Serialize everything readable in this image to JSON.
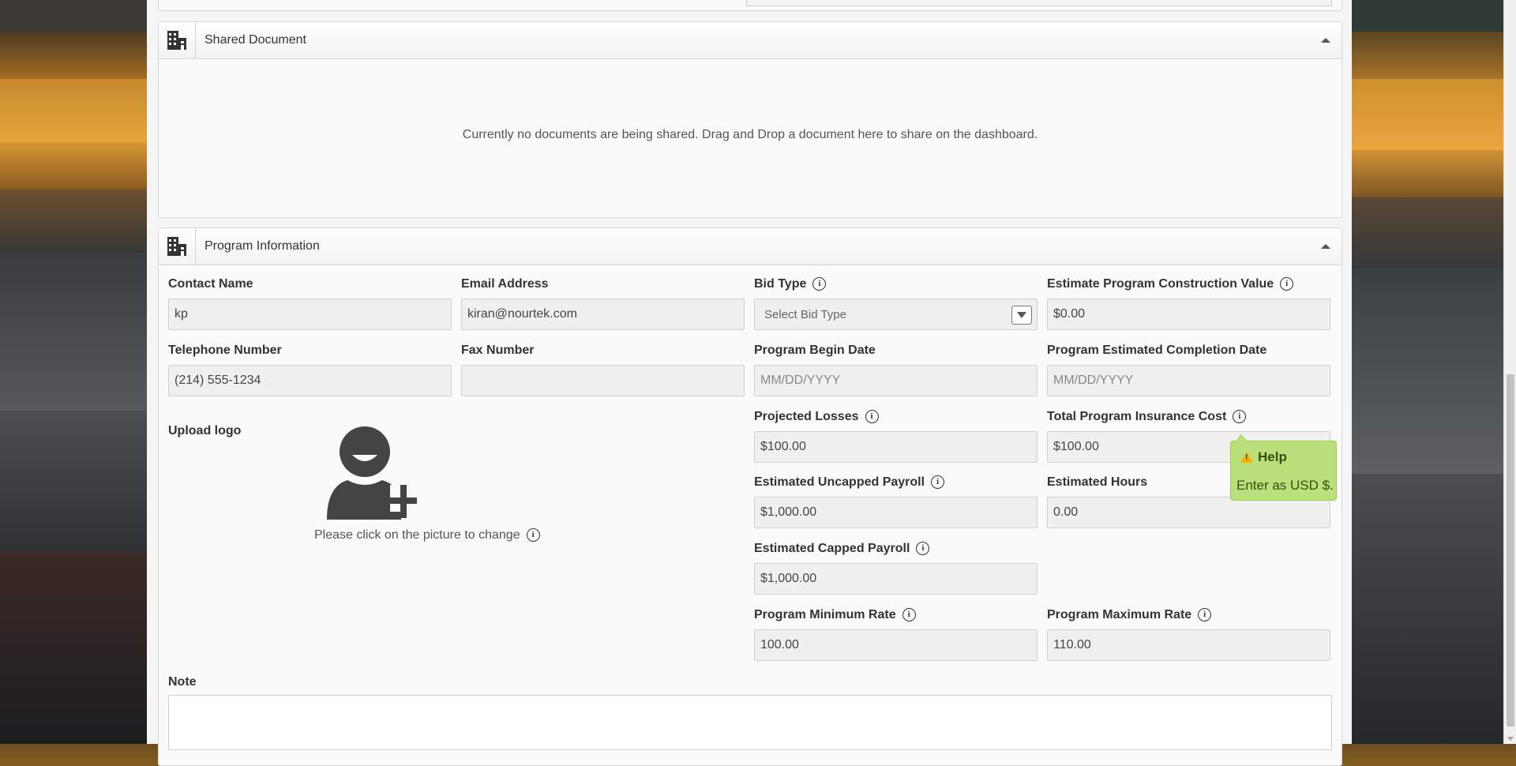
{
  "shared_document": {
    "title": "Shared Document",
    "empty_message": "Currently no documents are being shared. Drag and Drop a document here to share on the dashboard."
  },
  "program_information": {
    "title": "Program Information",
    "contact_name": {
      "label": "Contact Name",
      "value": "kp"
    },
    "email_address": {
      "label": "Email Address",
      "value": "kiran@nourtek.com"
    },
    "bid_type": {
      "label": "Bid Type",
      "value": "Select Bid Type"
    },
    "estimate_construction_value": {
      "label": "Estimate Program Construction Value",
      "value": "$0.00"
    },
    "telephone_number": {
      "label": "Telephone Number",
      "value": "(214) 555-1234"
    },
    "fax_number": {
      "label": "Fax Number",
      "value": ""
    },
    "program_begin_date": {
      "label": "Program Begin Date",
      "placeholder": "MM/DD/YYYY"
    },
    "program_completion_date": {
      "label": "Program Estimated Completion Date",
      "placeholder": "MM/DD/YYYY"
    },
    "upload_logo": {
      "label": "Upload logo",
      "caption": "Please click on the picture to change"
    },
    "projected_losses": {
      "label": "Projected Losses",
      "value": "$100.00"
    },
    "total_insurance_cost": {
      "label": "Total Program Insurance Cost",
      "value": "$100.00"
    },
    "estimated_uncapped_payroll": {
      "label": "Estimated Uncapped Payroll",
      "value": "$1,000.00"
    },
    "estimated_hours": {
      "label": "Estimated Hours",
      "value": "0.00"
    },
    "estimated_capped_payroll": {
      "label": "Estimated Capped Payroll",
      "value": "$1,000.00"
    },
    "program_minimum_rate": {
      "label": "Program Minimum Rate",
      "value": "100.00"
    },
    "program_maximum_rate": {
      "label": "Program Maximum Rate",
      "value": "110.00"
    },
    "note": {
      "label": "Note",
      "value": ""
    }
  },
  "help_tooltip": {
    "title": "Help",
    "body": "Enter as USD $."
  },
  "info_glyph": "i",
  "colors": {
    "tooltip_bg": "#b9e07a",
    "panel_bg": "#fafafa",
    "field_bg": "#f0f0f0"
  }
}
